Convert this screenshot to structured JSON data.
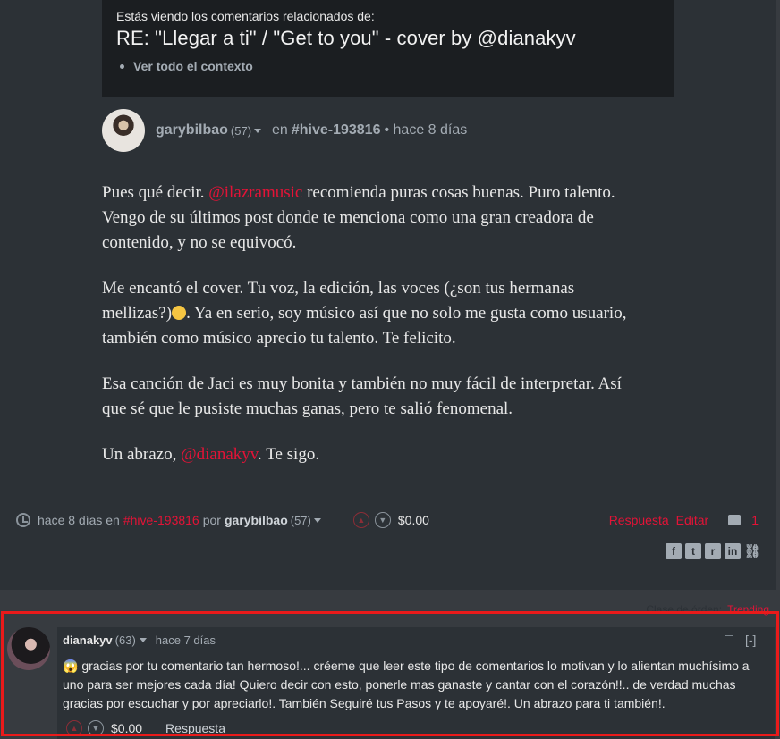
{
  "context": {
    "intro": "Estás viendo los comentarios relacionados de:",
    "title": "RE: \"Llegar a ti\" / \"Get to you\" - cover by @dianakyv",
    "view_context": "Ver todo el contexto"
  },
  "post": {
    "author": "garybilbao",
    "reputation": "(57)",
    "in_label": "en",
    "tag": "#hive-193816",
    "time": "• hace 8 días",
    "paragraphs": {
      "p1_before": "Pues qué decir. ",
      "p1_mention": "@ilazramusic",
      "p1_after": " recomienda puras cosas buenas. Puro talento. Vengo de su últimos post donde te menciona como una gran creadora de contenido, y no se equivocó.",
      "p2_before": "Me encantó el cover. Tu voz, la edición, las voces (¿son tus hermanas mellizas?)",
      "p2_after": ". Ya en serio, soy músico así que no solo me gusta como usuario, también como músico aprecio tu talento. Te felicito.",
      "p3": "Esa canción de Jaci es muy bonita y también no muy fácil de interpretar. Así que sé que le pusiste muchas ganas, pero te salió fenomenal.",
      "p4_before": "Un abrazo, ",
      "p4_mention": "@dianakyv",
      "p4_after": ". Te sigo."
    },
    "footer": {
      "time": "hace 8 días en",
      "tag": "#hive-193816",
      "by": "por",
      "author": "garybilbao",
      "reputation": "(57)",
      "payout": "$0.00",
      "reply": "Respuesta",
      "edit": "Editar",
      "comment_count": "1"
    }
  },
  "sort": {
    "label": "Clase de órden:",
    "value": "Trending"
  },
  "reply": {
    "author": "dianakyv",
    "reputation": "(63)",
    "time": "hace 7 días",
    "collapse": "[-]",
    "body": "😱 gracias por tu comentario tan hermoso!... créeme que leer este tipo de comentarios lo motivan y lo alientan muchísimo a uno para ser mejores cada día! Quiero decir con esto, ponerle mas ganaste y cantar con el corazón!!.. de verdad muchas gracias por escuchar y por apreciarlo!. También Seguiré tus Pasos y te apoyaré!. Un abrazo para ti también!.",
    "payout": "$0.00",
    "reply_label": "Respuesta"
  },
  "colors": {
    "accent": "#e31337",
    "highlight": "#ea1a1a",
    "background": "#373b40",
    "card": "#2c3136",
    "context_box": "#1b1e21"
  }
}
